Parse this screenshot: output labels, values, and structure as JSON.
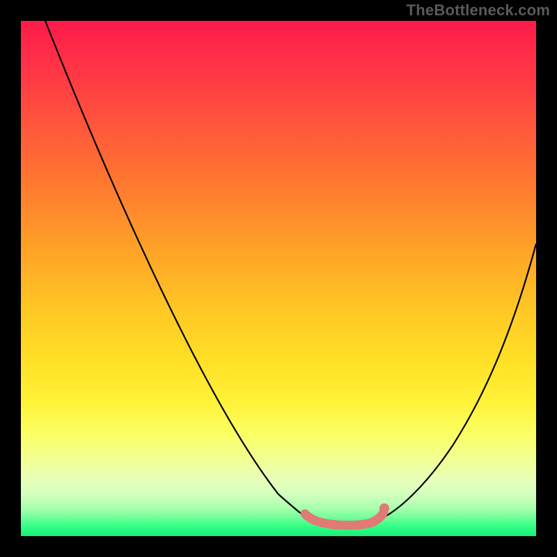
{
  "watermark": "TheBottleneck.com",
  "chart_data": {
    "type": "line",
    "title": "",
    "xlabel": "",
    "ylabel": "",
    "xlim": [
      0,
      1
    ],
    "ylim": [
      0,
      1
    ],
    "series": [
      {
        "name": "left-curve",
        "x": [
          0.047,
          0.55
        ],
        "y": [
          1.0,
          0.035
        ],
        "note": "black V-shaped left limb; approximately straight descent with slight curvature near the bottom"
      },
      {
        "name": "right-curve",
        "x": [
          0.7,
          1.0
        ],
        "y": [
          0.035,
          0.57
        ],
        "note": "black V-shaped right limb; rises with increasing slope toward the right edge"
      },
      {
        "name": "valley-overlay",
        "x": [
          0.55,
          0.58,
          0.63,
          0.67,
          0.695,
          0.705
        ],
        "y": [
          0.045,
          0.027,
          0.022,
          0.022,
          0.03,
          0.055
        ],
        "note": "thick pink/salmon segment and dot covering the curve trough"
      }
    ],
    "annotations": [],
    "colors": {
      "curve": "#000000",
      "valley_overlay": "#e07a76",
      "gradient_top": "#ff1a4a",
      "gradient_mid": "#ffe026",
      "gradient_bottom": "#17f07a"
    }
  }
}
